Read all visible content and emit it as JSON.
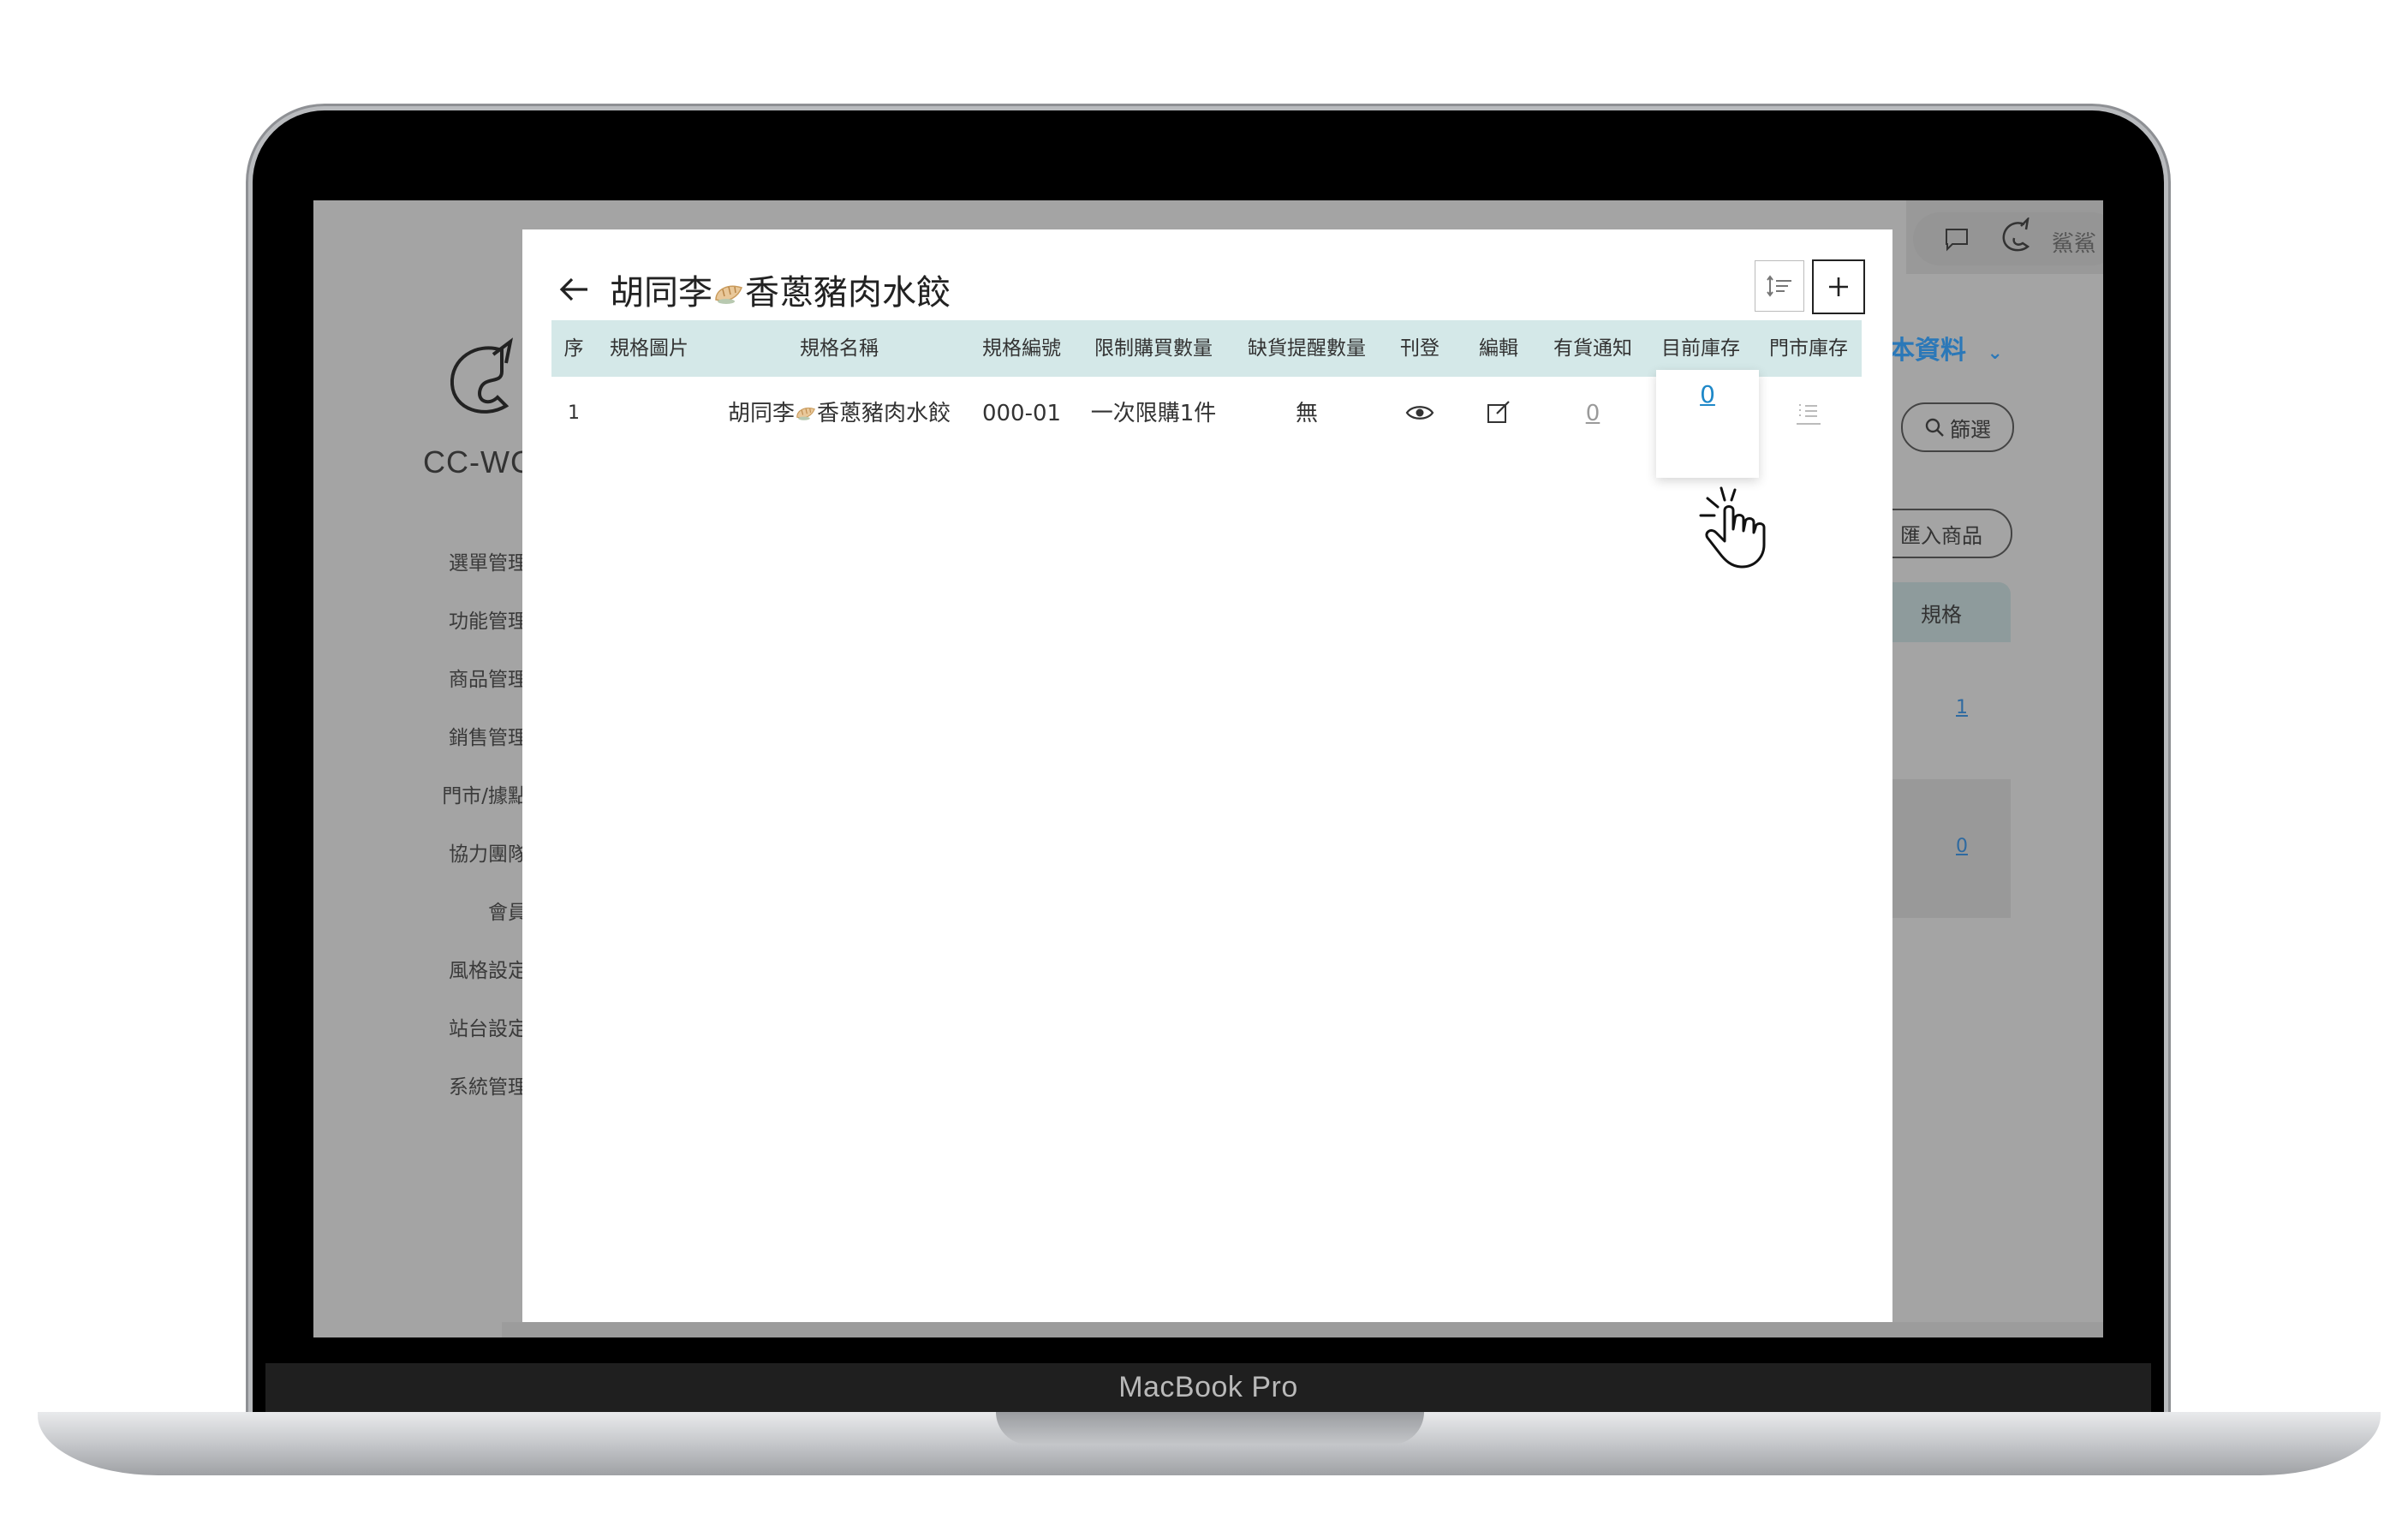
{
  "device": {
    "label": "MacBook Pro"
  },
  "background_app": {
    "logo_text": "CC-WC",
    "menu": [
      "選單管理",
      "功能管理",
      "商品管理",
      "銷售管理",
      "門市/據點",
      "協力團隊",
      "會員",
      "風格設定",
      "站台設定",
      "系統管理"
    ],
    "user_name": "鯊鯊",
    "section_link": "本資料",
    "filter_button": "篩選",
    "import_button": "匯入商品",
    "column_header": "規格",
    "row_values": [
      "1",
      "0"
    ]
  },
  "modal": {
    "title_left": "胡同李",
    "title_right": "香蔥豬肉水餃",
    "columns": [
      "序",
      "規格圖片",
      "規格名稱",
      "規格編號",
      "限制購買數量",
      "缺貨提醒數量",
      "刊登",
      "編輯",
      "有貨通知",
      "目前庫存",
      "門市庫存"
    ],
    "rows": [
      {
        "index": "1",
        "name_left": "胡同李",
        "name_right": "香蔥豬肉水餃",
        "code": "000-01",
        "purchase_limit": "一次限購1件",
        "low_stock_alert": "無",
        "restock_notify": "0",
        "current_stock": "0"
      }
    ]
  },
  "colors": {
    "header_bg": "#d4e8e8",
    "link_blue": "#1e88c8",
    "overlay": "#a4a4a4"
  },
  "icons": [
    "back-arrow-icon",
    "sort-icon",
    "plus-icon",
    "eye-icon",
    "edit-icon",
    "list-icon",
    "dumpling-icon",
    "hand-pointer-icon"
  ]
}
